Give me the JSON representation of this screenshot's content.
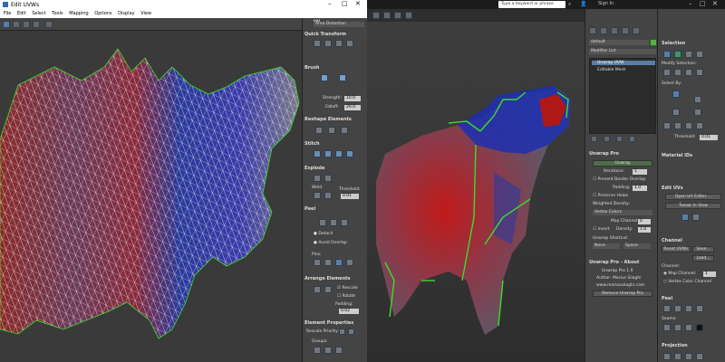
{
  "uvw_window": {
    "title": "Edit UVWs",
    "menu": [
      "File",
      "Edit",
      "Select",
      "Tools",
      "Mapping",
      "Options",
      "Display",
      "View"
    ],
    "uv_label": "UV",
    "dropdown": "Area Distortion"
  },
  "rollouts": {
    "quick_transform": "Quick Transform",
    "brush": "Brush",
    "strength_label": "Strength:",
    "strength_value": "10.0",
    "falloff_label": "Falloff:",
    "falloff_value": "20.0",
    "reshape": "Reshape Elements",
    "stitch": "Stitch",
    "explode": "Explode",
    "weld": "Weld",
    "threshold_label": "Threshold:",
    "threshold_value": "0.01",
    "peel": "Peel",
    "detach": "Detach",
    "avoid_overlap": "Avoid Overlap",
    "pins": "Pins:",
    "arrange": "Arrange Elements",
    "rescale": "Rescale",
    "rotate": "Rotate",
    "padding_label": "Padding:",
    "padding_value": "0.02",
    "element_props": "Element Properties",
    "rescale_priority": "Rescale Priority:",
    "groups": "Groups:"
  },
  "topbar": {
    "search_placeholder": "Type a keyword or phrase",
    "sign_in": "Sign In"
  },
  "command_panel": {
    "object_name": "default",
    "modifier_list": "Modifier List",
    "stack": [
      "Unwrap UVW",
      "Editable Mesh"
    ],
    "unwrap_pro": {
      "title": "Unwrap Pro",
      "unwrap_btn": "Unwrap",
      "iterations_label": "Iterations:",
      "iterations_value": "1",
      "prevent_border_overlap": "Prevent Border Overlap",
      "padding_label": "Padding:",
      "padding_value": "1.0",
      "preserve_holes": "Preserve Holes",
      "weighted_density": "Weighted Density:",
      "vertex_colors": "Vertex Colors",
      "map_channel_label": "Map Channel:",
      "map_channel_value": "0",
      "invert": "Invert",
      "density_label": "Density:",
      "density_value": "1.0",
      "shortcut_label": "Unwrap Shortcut:",
      "shortcut_none": "None",
      "shortcut_key": "Space"
    },
    "about": {
      "title": "Unwrap Pro - About",
      "line1": "Unwrap Pro 1.0",
      "line2": "Author: Marius Silaghi",
      "line3": "www.mariussilaghi.com",
      "remove_btn": "Remove Unwrap Pro"
    }
  },
  "side_panel": {
    "selection": "Selection",
    "modify_selection": "Modify Selection:",
    "select_by": "Select By:",
    "threshold_label": "Threshold:",
    "threshold_value": "0.01",
    "material_ids": "Material IDs",
    "edit_uvs": "Edit UVs",
    "open_uv_editor": "Open UV Editor ...",
    "tweak_in_view": "Tweak In View",
    "channel": "Channel",
    "reset_uvws": "Reset UVWs",
    "save": "Save...",
    "load": "Load...",
    "channel_label": "Channel:",
    "map_channel_label": "Map Channel:",
    "map_channel_value": "1",
    "vertex_color_channel": "Vertex Color Channel",
    "peel": "Peel",
    "seams": "Seams:",
    "projection": "Projection"
  },
  "colors": {
    "red": "#b01818",
    "blue": "#1d2fb0",
    "green": "#3cdc2a",
    "accent": "#5b7da3"
  }
}
